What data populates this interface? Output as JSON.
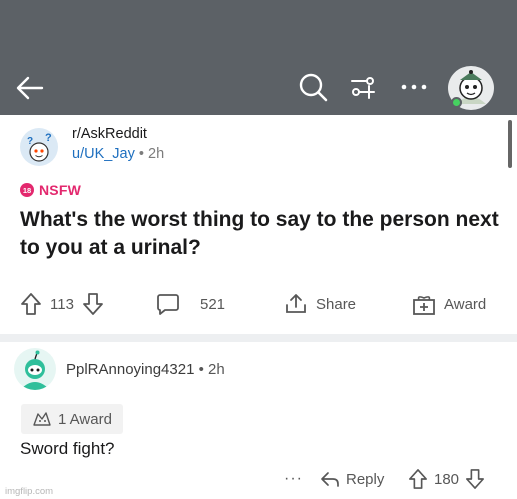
{
  "topbar": {
    "back_icon": "arrow-left-icon",
    "search_icon": "search-icon",
    "filter_icon": "sort-filter-icon",
    "more_icon": "more-dots-icon",
    "avatar_icon": "user-avatar-icon",
    "bg_color": "#5c6166"
  },
  "post": {
    "subreddit": "r/AskReddit",
    "author": "u/UK_Jay",
    "separator": "•",
    "age": "2h",
    "nsfw_badge": "18",
    "nsfw_label": "NSFW",
    "title": "What's the worst thing to say to the person next to you at a urinal?",
    "upvotes": "113",
    "comments": "521",
    "share_label": "Share",
    "award_label": "Award"
  },
  "comment": {
    "author": "PplRAnnoying4321",
    "separator": "•",
    "age": "2h",
    "award_text": "1 Award",
    "body": "Sword fight?",
    "more": "···",
    "reply_label": "Reply",
    "score": "180"
  },
  "colors": {
    "nsfw": "#e3286e",
    "username": "#1e6fbf",
    "online": "#46d160"
  },
  "watermark": "imgflip.com"
}
